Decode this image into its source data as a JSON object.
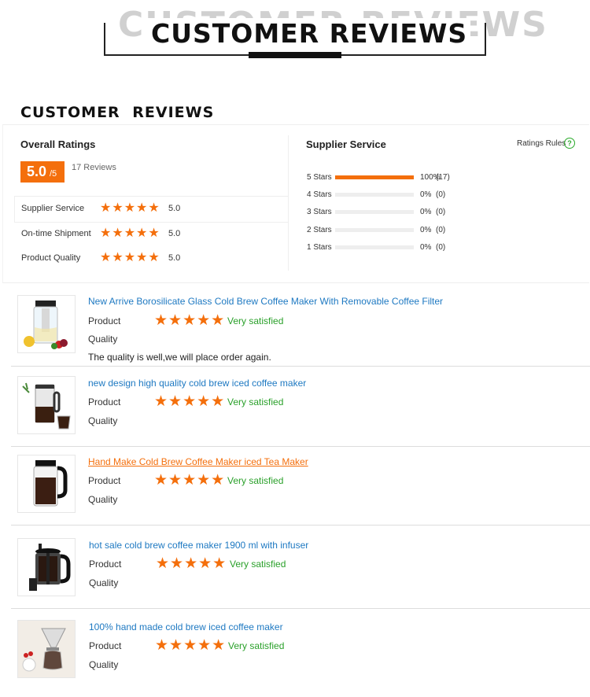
{
  "banner": {
    "title": "CUSTOMER REVIEWS",
    "shadow_title": "CUSTOMER REVIEWS"
  },
  "section_title": "CUSTOMER REVIEWS",
  "overall": {
    "label": "Overall Ratings",
    "score": "5.0",
    "out_of": "/5",
    "review_count": "17 Reviews",
    "rows": [
      {
        "label": "Supplier Service",
        "value": "5.0",
        "stars": 5
      },
      {
        "label": "On-time Shipment",
        "value": "5.0",
        "stars": 5
      },
      {
        "label": "Product Quality",
        "value": "5.0",
        "stars": 5
      }
    ]
  },
  "supplier": {
    "label": "Supplier Service",
    "rules_label": "Ratings Rules",
    "rules_icon": "question-circle-icon",
    "bars": [
      {
        "label": "5 Stars",
        "percent": "100%",
        "count": "(17)",
        "fill": 1.0
      },
      {
        "label": "4 Stars",
        "percent": "0%",
        "count": "(0)",
        "fill": 0
      },
      {
        "label": "3 Stars",
        "percent": "0%",
        "count": "(0)",
        "fill": 0
      },
      {
        "label": "2 Stars",
        "percent": "0%",
        "count": "(0)",
        "fill": 0
      },
      {
        "label": "1 Stars",
        "percent": "0%",
        "count": "(0)",
        "fill": 0
      }
    ]
  },
  "reviews": [
    {
      "title": "New Arrive Borosilicate Glass Cold Brew Coffee Maker With Removable Coffee Filter",
      "label1": "Product",
      "label2": "Quality",
      "stars": 5,
      "satisfaction": "Very satisfied",
      "comment": "The quality is well,we will place order again."
    },
    {
      "title": "new design high quality cold brew iced coffee maker",
      "label1": "Product",
      "label2": "Quality",
      "stars": 5,
      "satisfaction": "Very satisfied"
    },
    {
      "title": "Hand Make Cold Brew Coffee Maker iced Tea Maker",
      "label1": "Product",
      "label2": "Quality",
      "stars": 5,
      "satisfaction": "Very satisfied"
    },
    {
      "title": "hot sale cold brew coffee maker 1900 ml with infuser",
      "label1": "Product",
      "label2": "Quality",
      "stars": 5,
      "satisfaction": "Very satisfied"
    },
    {
      "title": "100% hand made cold brew iced coffee maker",
      "label1": "Product",
      "label2": "Quality",
      "stars": 5,
      "satisfaction": "Very satisfied"
    }
  ],
  "colors": {
    "accent": "#f46f0c",
    "link": "#1e79c2",
    "success": "#2aa02a"
  },
  "star_glyph": "★★★★★"
}
